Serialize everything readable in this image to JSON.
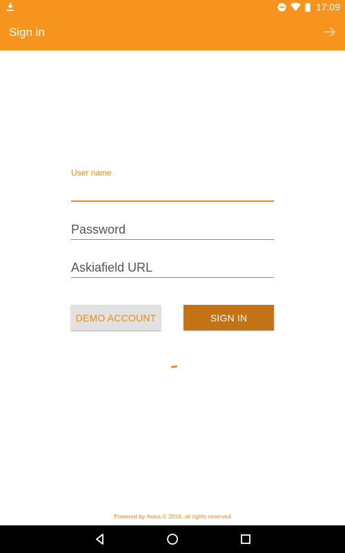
{
  "status_bar": {
    "time": "17:09",
    "icons": [
      "download-icon",
      "do-not-disturb-icon",
      "wifi-icon",
      "battery-icon"
    ]
  },
  "app_bar": {
    "title": "Sign in",
    "action_icon": "arrow-forward-icon"
  },
  "form": {
    "username_label": "User name",
    "username_value": "",
    "password_placeholder": "Password",
    "url_placeholder": "Askiafield URL",
    "demo_button": "DEMO ACCOUNT",
    "signin_button": "SIGN IN"
  },
  "footer": {
    "text": "Powered by Askia © 2016, all rights reserved"
  },
  "nav_bar": {
    "icons": [
      "back-icon",
      "home-icon",
      "recent-apps-icon"
    ]
  },
  "colors": {
    "brand": "#f7941d",
    "accent": "#f08a14",
    "button_primary": "#c47216",
    "button_secondary": "#e1e1e1"
  }
}
